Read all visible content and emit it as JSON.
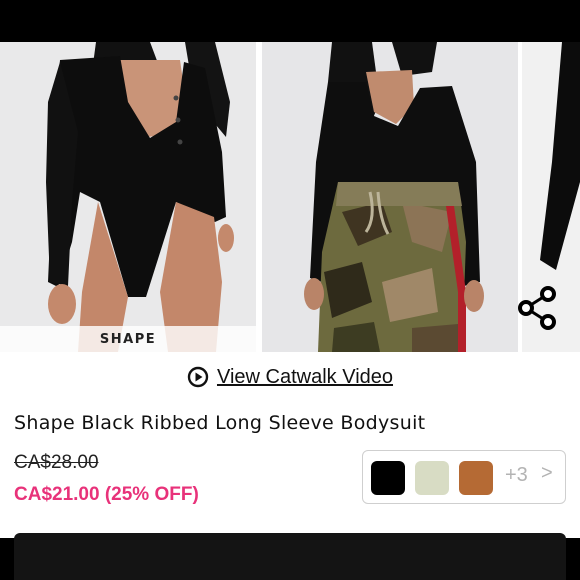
{
  "gallery": {
    "tag_label": "SHAPE"
  },
  "catwalk": {
    "label": "View Catwalk Video"
  },
  "product": {
    "title": "Shape Black Ribbed Long Sleeve Bodysuit",
    "original_price": "CA$28.00",
    "sale_price": "CA$21.00 (25% OFF)"
  },
  "colors": {
    "accent_sale": "#e8327a",
    "swatch_1": "#000000",
    "swatch_2": "#d8dcc4",
    "swatch_3": "#b56a34"
  },
  "swatch_picker": {
    "more_count": "+3",
    "chevron": ">"
  }
}
